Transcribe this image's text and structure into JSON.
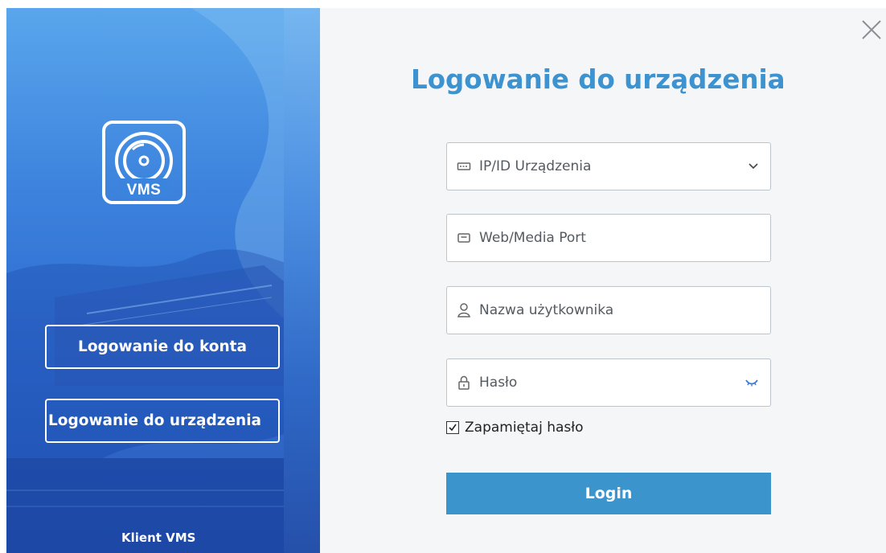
{
  "app_name": "Klient VMS",
  "logo": {
    "text": "VMS"
  },
  "sidebar": {
    "account_login_label": "Logowanie do konta",
    "device_login_label": "Logowanie do urządzenia"
  },
  "main": {
    "title": "Logowanie do urządzenia",
    "fields": {
      "ip_id": {
        "placeholder": "IP/ID Urządzenia",
        "value": ""
      },
      "port": {
        "placeholder": "Web/Media Port",
        "value": ""
      },
      "username": {
        "placeholder": "Nazwa użytkownika",
        "value": ""
      },
      "password": {
        "placeholder": "Hasło",
        "value": ""
      }
    },
    "remember": {
      "label": "Zapamiętaj hasło",
      "checked": true
    },
    "login_label": "Login"
  },
  "colors": {
    "accent": "#3b95cc",
    "title": "#3d93cf",
    "panel_blue": "#2e6cd0"
  },
  "icons": [
    "close-icon",
    "vms-logo-icon",
    "ip-icon",
    "port-icon",
    "user-icon",
    "lock-icon",
    "chevron-down-icon",
    "eye-closed-icon",
    "checkmark-icon"
  ]
}
